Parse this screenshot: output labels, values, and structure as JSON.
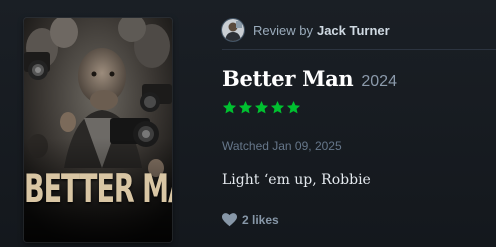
{
  "poster": {
    "title_text": "BETTER MAN"
  },
  "review": {
    "byline_prefix": "Review by",
    "author": "Jack Turner",
    "film_title": "Better Man",
    "year": "2024",
    "rating_stars": 5,
    "rating_max": 5,
    "star_color": "#00c030",
    "watched": "Watched Jan 09, 2025",
    "text": "Light ‘em up, Robbie",
    "likes": "2 likes"
  },
  "icons": {
    "avatar": "avatar",
    "star": "star-icon",
    "heart": "heart-icon"
  }
}
